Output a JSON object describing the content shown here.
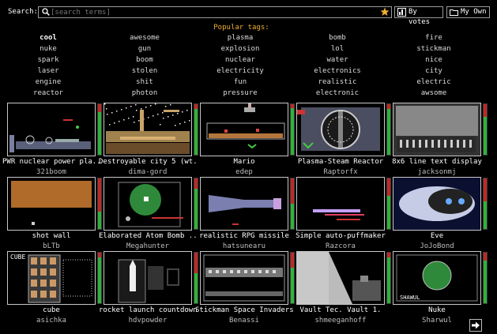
{
  "search": {
    "label": "Search:",
    "placeholder": "[search terms]"
  },
  "buttons": {
    "by_votes": "By votes",
    "my_own": "My Own"
  },
  "tags_title": "Popular tags:",
  "tags": [
    [
      "cool",
      "awesome",
      "plasma",
      "bomb",
      "fire"
    ],
    [
      "nuke",
      "gun",
      "explosion",
      "lol",
      "stickman"
    ],
    [
      "spark",
      "boom",
      "nuclear",
      "water",
      "nice"
    ],
    [
      "laser",
      "stolen",
      "electricity",
      "electronics",
      "city"
    ],
    [
      "engine",
      "shit",
      "fun",
      "realistic",
      "electric"
    ],
    [
      "reactor",
      "photon",
      "pressure",
      "electronic",
      "awsome"
    ]
  ],
  "saves": [
    {
      "title": "PWR nuclear power pla...",
      "author": "321boom",
      "score": 0.85,
      "thumb": "reactor"
    },
    {
      "title": "Destroyable city 5 (wt...",
      "author": "dima-gord",
      "score": 0.9,
      "thumb": "city"
    },
    {
      "title": "Mario",
      "author": "edep",
      "score": 0.92,
      "thumb": "mario"
    },
    {
      "title": "Plasma-Steam Reactor",
      "author": "Raptorfx",
      "score": 0.9,
      "thumb": "wheel"
    },
    {
      "title": "8x6 line text display",
      "author": "jacksonmj",
      "score": 0.75,
      "thumb": "display"
    },
    {
      "title": "shot wall",
      "author": "bLTb",
      "score": 0.35,
      "thumb": "wall"
    },
    {
      "title": "Elaborated Atom Bomb ...",
      "author": "Megahunter",
      "score": 0.8,
      "thumb": "atom"
    },
    {
      "title": "realistic RPG missile",
      "author": "hatsunearu",
      "score": 0.5,
      "thumb": "missile"
    },
    {
      "title": "Simple auto-puffmaker",
      "author": "Razcora",
      "score": 0.65,
      "thumb": "puff"
    },
    {
      "title": "Eve",
      "author": "JoJoBond",
      "score": 0.55,
      "thumb": "eve"
    },
    {
      "title": "cube",
      "author": "asichka",
      "score": 0.9,
      "thumb": "cube"
    },
    {
      "title": "rocket launch countdown",
      "author": "hdvpowder",
      "score": 0.6,
      "thumb": "rocket"
    },
    {
      "title": "Stickman Space Invaders",
      "author": "Benassi",
      "score": 0.7,
      "thumb": "invaders"
    },
    {
      "title": "Vault Tec. Vault 1.",
      "author": "shmeeganhoff",
      "score": 0.9,
      "thumb": "vault"
    },
    {
      "title": "Nuke",
      "author": "Sharwul",
      "score": 0.85,
      "thumb": "nuke"
    }
  ],
  "thumb_labels": {
    "cube_title": "CUBE",
    "nuke_label": "SHAWUL"
  },
  "colors": {
    "accent": "#f0b030",
    "vote_up": "#2fb33a",
    "vote_down": "#c02828"
  }
}
